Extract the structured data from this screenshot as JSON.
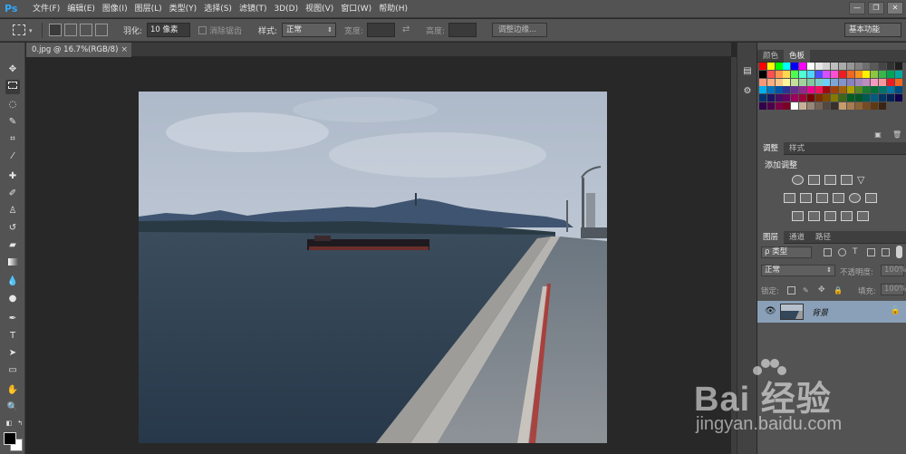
{
  "app": {
    "logo": "Ps"
  },
  "menu": [
    "文件(F)",
    "编辑(E)",
    "图像(I)",
    "图层(L)",
    "类型(Y)",
    "选择(S)",
    "滤镜(T)",
    "3D(D)",
    "视图(V)",
    "窗口(W)",
    "帮助(H)"
  ],
  "window_controls": {
    "minimize": "—",
    "restore": "❐",
    "close": "✕"
  },
  "options": {
    "feather_label": "羽化:",
    "feather_value": "10 像素",
    "antialias_label": "消除锯齿",
    "style_label": "样式:",
    "style_value": "正常",
    "width_label": "宽度:",
    "height_label": "高度:",
    "refine_edge": "调整边缘...",
    "workspace": "基本功能"
  },
  "document": {
    "tab_label": "0.jpg @ 16.7%(RGB/8)",
    "close": "×"
  },
  "panels": {
    "color_tabs": [
      "颜色",
      "色板"
    ],
    "adjust_tabs": [
      "调整",
      "样式"
    ],
    "adjust_title": "添加调整",
    "layers_tabs": [
      "图层",
      "通道",
      "路径"
    ],
    "kind_filter": "ρ 类型",
    "blend_mode": "正常",
    "opacity_label": "不透明度:",
    "opacity_value": "100%",
    "lock_label": "锁定:",
    "fill_label": "填充:",
    "fill_value": "100%",
    "layer_name": "背景"
  },
  "watermark": {
    "main": "Bai 经验",
    "sub": "jingyan.baidu.com"
  },
  "colors": {
    "ui_dark": "#282828",
    "ui_mid": "#535353",
    "ps_blue": "#31a8ff",
    "layer_selected": "#8aa0b8"
  },
  "swatch_colors": [
    [
      "#ff0000",
      "#ffff00",
      "#00ff00",
      "#00ffff",
      "#0000ff",
      "#ff00ff",
      "#ffffff",
      "#e6e6e6",
      "#d2d2d2",
      "#bebebe",
      "#aaaaaa",
      "#969696",
      "#828282",
      "#6e6e6e",
      "#5a5a5a",
      "#464646",
      "#323232",
      "#1e1e1e"
    ],
    [
      "#000000",
      "#ff4f4f",
      "#ff944f",
      "#ffd64f",
      "#4fff4f",
      "#4fffd6",
      "#4fd6ff",
      "#4f4fff",
      "#d64fff",
      "#ff4fd6",
      "#ed1c24",
      "#f26522",
      "#f7941d",
      "#fff200",
      "#8dc63f",
      "#39b54a",
      "#00a651",
      "#00a99d"
    ],
    [
      "#f7977a",
      "#f9ad81",
      "#fdc68a",
      "#fff79a",
      "#c4df9b",
      "#a3d39c",
      "#82ca9d",
      "#7bcdc8",
      "#6ecff6",
      "#7ea7d8",
      "#8493ca",
      "#8882be",
      "#a187be",
      "#bc8dbf",
      "#f49ac2",
      "#f6989d",
      "#ed1c24",
      "#f26522"
    ],
    [
      "#00aeef",
      "#0072bc",
      "#0054a6",
      "#2e3192",
      "#662d91",
      "#92278f",
      "#ec008c",
      "#ed145b",
      "#9e0b0f",
      "#a0410d",
      "#a36209",
      "#aba000",
      "#598527",
      "#1a7b30",
      "#007236",
      "#00746b",
      "#0076a3",
      "#004b80"
    ],
    [
      "#003471",
      "#1b1464",
      "#440e62",
      "#630460",
      "#9e005d",
      "#9e0039",
      "#790000",
      "#7b2e00",
      "#7d4900",
      "#827b00",
      "#406618",
      "#005e20",
      "#005826",
      "#005952",
      "#005b7f",
      "#003663",
      "#002157",
      "#0d004c"
    ],
    [
      "#32004b",
      "#4b0049",
      "#7b0046",
      "#7a0026",
      "#ffffff",
      "#c7b299",
      "#998675",
      "#736357",
      "#534741",
      "#37302d",
      "#c69c6d",
      "#a67c52",
      "#8c6239",
      "#754c24",
      "#603913",
      "#3c2415"
    ]
  ]
}
